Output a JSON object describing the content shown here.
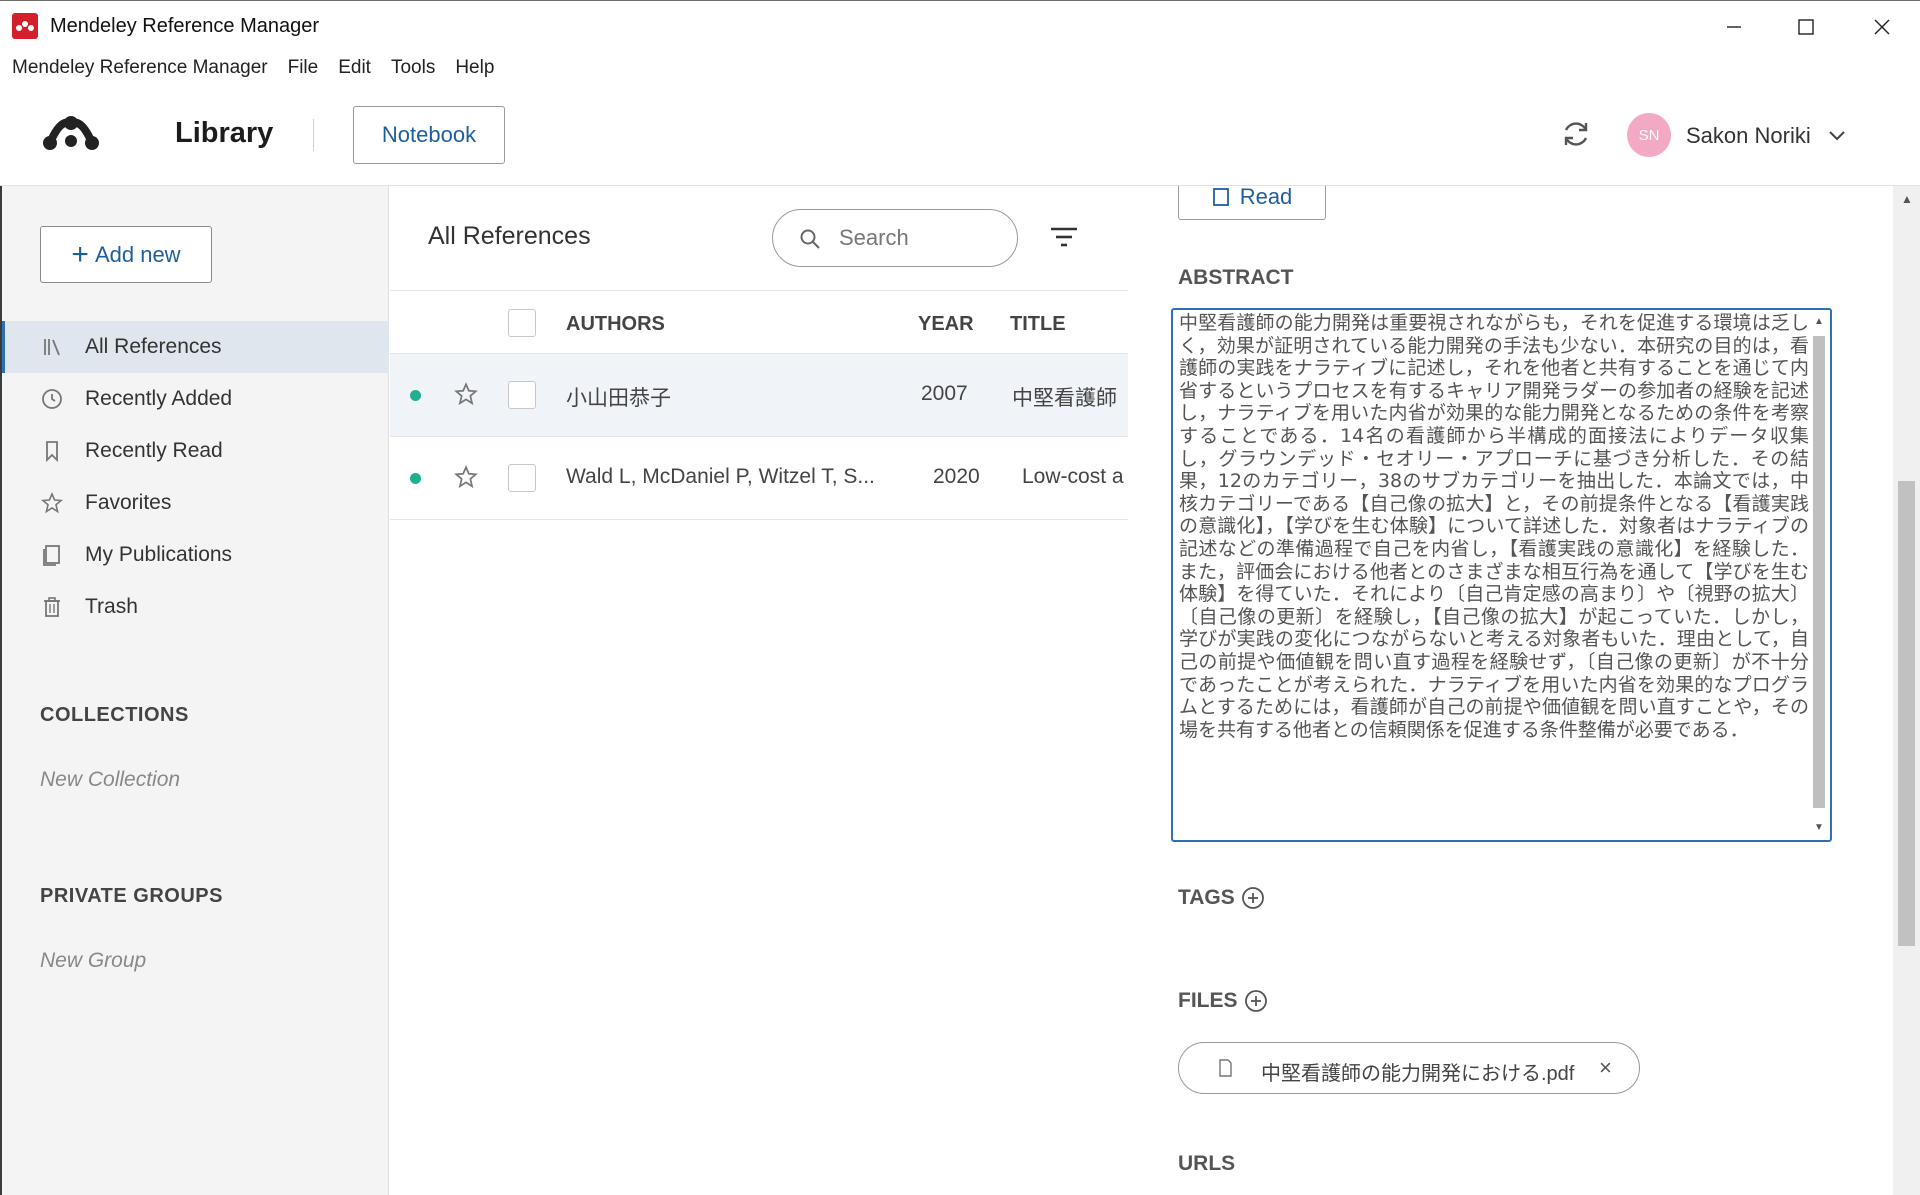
{
  "window": {
    "title": "Mendeley Reference Manager",
    "min_symbol": "—",
    "max_symbol": "☐",
    "close_symbol": "✕"
  },
  "menu": [
    "Mendeley Reference Manager",
    "File",
    "Edit",
    "Tools",
    "Help"
  ],
  "header": {
    "library_label": "Library",
    "notebook_label": "Notebook",
    "user_initials": "SN",
    "user_name": "Sakon Noriki"
  },
  "sidebar": {
    "add_new_label": "Add new",
    "add_new_plus": "+",
    "items": [
      {
        "label": "All References",
        "icon": "library-icon",
        "active": true
      },
      {
        "label": "Recently Added",
        "icon": "clock-icon",
        "active": false
      },
      {
        "label": "Recently Read",
        "icon": "bookmark-icon",
        "active": false
      },
      {
        "label": "Favorites",
        "icon": "star-icon",
        "active": false
      },
      {
        "label": "My Publications",
        "icon": "publication-icon",
        "active": false
      },
      {
        "label": "Trash",
        "icon": "trash-icon",
        "active": false
      }
    ],
    "collections_heading": "COLLECTIONS",
    "new_collection_label": "New Collection",
    "groups_heading": "PRIVATE GROUPS",
    "new_group_label": "New Group"
  },
  "list": {
    "title": "All References",
    "search_placeholder": "Search",
    "columns": {
      "authors": "AUTHORS",
      "year": "YEAR",
      "title": "TITLE"
    },
    "rows": [
      {
        "authors": "小山田恭子",
        "year": "2007",
        "title": "中堅看護師",
        "selected": true
      },
      {
        "authors": "Wald L, McDaniel P, Witzel T, S...",
        "year": "2020",
        "title": "Low-cost a",
        "selected": false
      }
    ]
  },
  "details": {
    "read_label": "Read",
    "abstract_heading": "ABSTRACT",
    "abstract_text": "中堅看護師の能力開発は重要視されながらも，それを促進する環境は乏しく，効果が証明されている能力開発の手法も少ない．本研究の目的は，看護師の実践をナラティブに記述し，それを他者と共有することを通じて内省するというプロセスを有するキャリア開発ラダーの参加者の経験を記述し，ナラティブを用いた内省が効果的な能力開発となるための条件を考察することである．14名の看護師から半構成的面接法によりデータ収集し，グラウンデッド・セオリー・アプローチに基づき分析した．その結果，12のカテゴリー，38のサブカテゴリーを抽出した．本論文では，中核カテゴリーである【自己像の拡大】と，その前提条件となる【看護実践の意識化】，【学びを生む体験】について詳述した．対象者はナラティブの記述などの準備過程で自己を内省し，【看護実践の意識化】を経験した．また，評価会における他者とのさまざまな相互行為を通して【学びを生む体験】を得ていた．それにより〔自己肯定感の高まり〕や〔視野の拡大〕〔自己像の更新〕を経験し，【自己像の拡大】が起こっていた．しかし，学びが実践の変化につながらないと考える対象者もいた．理由として，自己の前提や価値観を問い直す過程を経験せず，〔自己像の更新〕が不十分であったことが考えられた．ナラティブを用いた内省を効果的なプログラムとするためには，看護師が自己の前提や価値観を問い直すことや，その場を共有する他者との信頼関係を促進する条件整備が必要である．",
    "tags_heading": "TAGS",
    "files_heading": "FILES",
    "file_name": "中堅看護師の能力開発における.pdf",
    "file_close": "×",
    "urls_heading": "URLS"
  },
  "colors": {
    "accent": "#2f6fb3",
    "link_text": "#1f5e9e",
    "unread_dot": "#1fb08f",
    "avatar_bg": "#f3a8c3",
    "app_icon": "#d3202b"
  }
}
